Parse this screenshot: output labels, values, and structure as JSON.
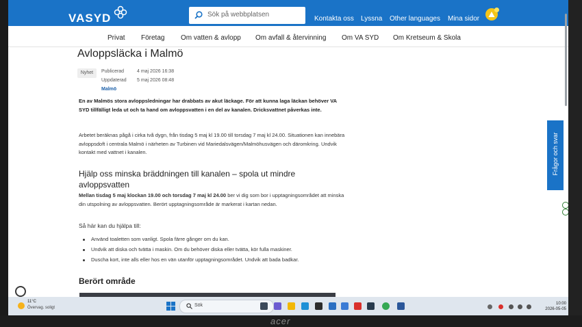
{
  "header": {
    "logo": "VASYD",
    "search_placeholder": "Sök på webbplatsen",
    "links": [
      "Kontakta oss",
      "Lyssna",
      "Other languages",
      "Mina sidor"
    ]
  },
  "nav": [
    "Privat",
    "Företag",
    "Om vatten & avlopp",
    "Om avfall & återvinning",
    "Om VA SYD",
    "Om Kretseum & Skola"
  ],
  "article": {
    "title": "Avloppsläcka i Malmö",
    "badge": "Nyhet",
    "published_label": "Publicerad",
    "published_value": "4 maj 2026 16:38",
    "updated_label": "Uppdaterad",
    "updated_value": "5 maj 2026 08:48",
    "tag": "Malmö",
    "intro": "En av Malmös stora avloppsledningar har drabbats av akut läckage. För att kunna laga läckan behöver VA SYD tillfälligt leda ut och ta hand om avloppsvatten i en del av kanalen. Dricksvattnet påverkas inte.",
    "para1": "Arbetet beräknas pågå i cirka två dygn, från tisdag 5 maj kl 19.00 till torsdag 7 maj kl 24.00. Situationen kan innebära avloppsdoft i centrala Malmö i närheten av Turbinen vid Mariedalsvägen/Malmöhusvägen och däromkring. Undvik kontakt med vattnet i kanalen.",
    "h2": "Hjälp oss minska bräddningen till kanalen – spola ut mindre avloppsvatten",
    "para2_bold": "Mellan tisdag 5 maj klockan 19.00 och torsdag 7 maj kl 24.00",
    "para2_rest": " ber vi dig som bor i upptagningsområdet att minska din utspolning av avloppsvatten. Berört upptagningsområde är markerat i kartan nedan.",
    "how_to_help": "Så här kan du hjälpa till:",
    "bullets": [
      "Använd toaletten som vanligt. Spola färre gånger om du kan.",
      "Undvik att diska och tvätta i maskin. Om du behöver diska eller tvätta, kör fulla maskiner.",
      "Duscha kort, inte alls eller hos en vän utanför upptagningsområdet. Undvik att bada badkar."
    ],
    "h3": "Berört område"
  },
  "faq_button": "Frågor och svar",
  "taskbar": {
    "temperature": "11°C",
    "weather": "Övervag. soligt",
    "search_placeholder": "Sök",
    "time": "10:00",
    "date": "2026-05-05"
  },
  "monitor_brand": "acer",
  "colors": {
    "brand_blue": "#1a73c7",
    "warning": "#f5c518"
  }
}
